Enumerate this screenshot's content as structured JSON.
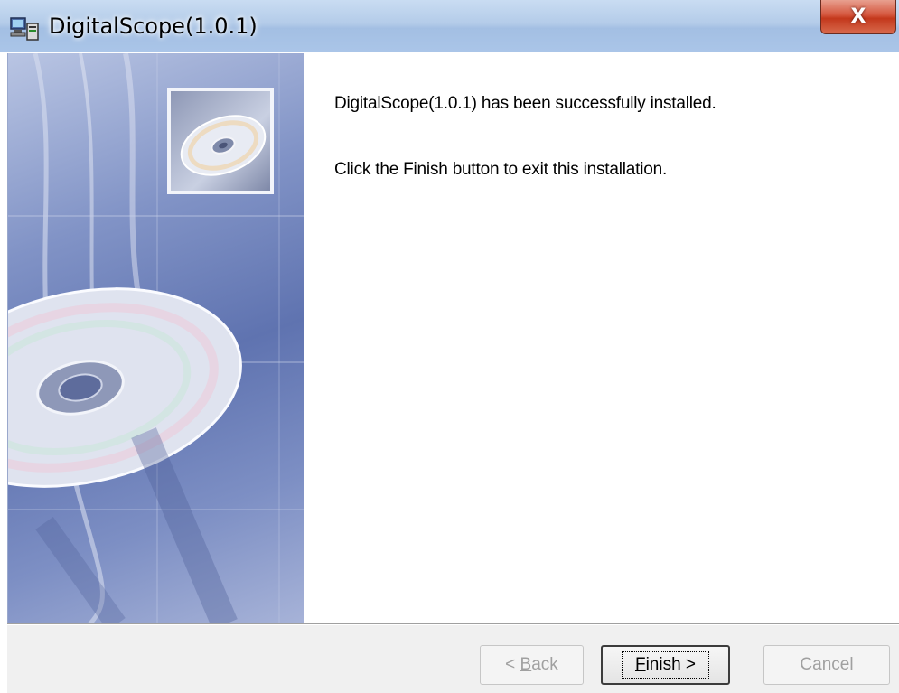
{
  "window": {
    "title": "DigitalScope(1.0.1)",
    "close_label": "X",
    "app_icon": "installer-computer-icon"
  },
  "side_panel": {
    "image": "cd-disc-artwork",
    "thumbnail_icon": "cd-disc-icon"
  },
  "content": {
    "message_installed": "DigitalScope(1.0.1) has been successfully installed.",
    "message_finish": "Click the Finish button to exit this installation."
  },
  "footer": {
    "back_prefix": "< ",
    "back_accel": "B",
    "back_rest": "ack",
    "finish_accel": "F",
    "finish_rest": "inish >",
    "cancel_label": "Cancel",
    "back_enabled": false,
    "cancel_enabled": false
  }
}
